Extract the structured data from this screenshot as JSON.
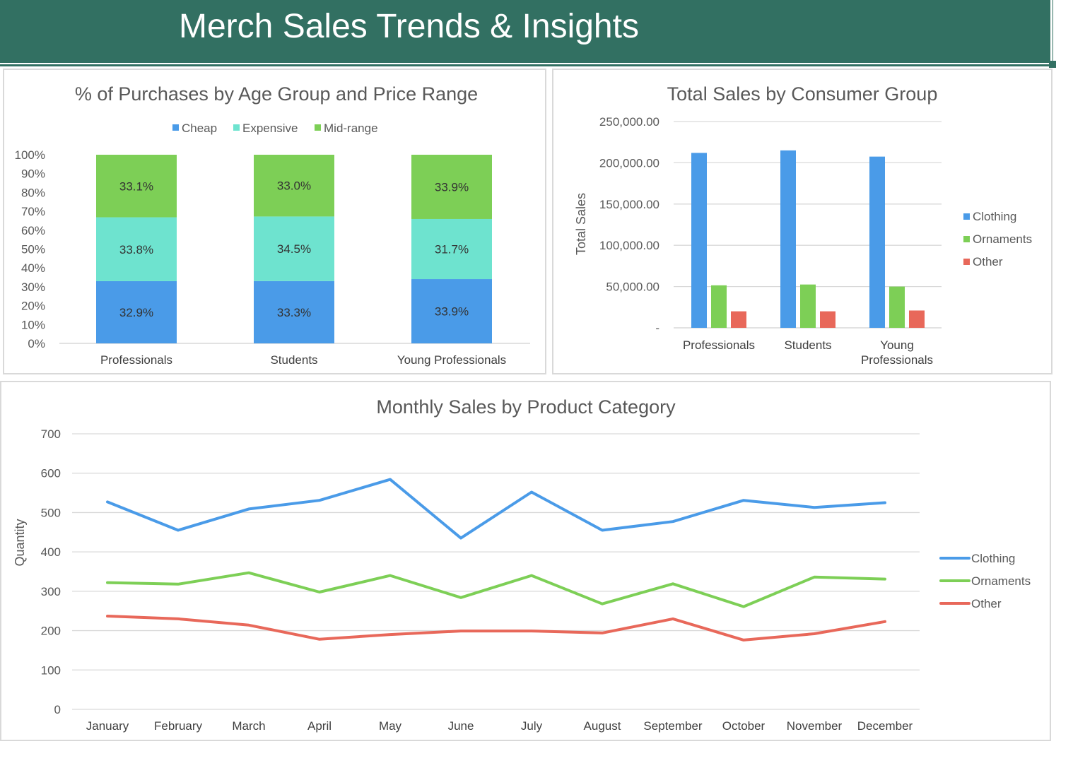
{
  "header": {
    "title": "Merch Sales Trends & Insights"
  },
  "colors": {
    "banner": "#327062",
    "clothing": "#4a9be8",
    "ornaments": "#7dcf56",
    "other": "#e8685a",
    "cheap": "#4a9be8",
    "expensive": "#6ee3cf",
    "midrange": "#7dcf56"
  },
  "chart_data": [
    {
      "type": "bar",
      "stacked": "percent",
      "title": "% of Purchases by Age Group and Price Range",
      "xlabel": "",
      "ylabel": "",
      "categories": [
        "Professionals",
        "Students",
        "Young Professionals"
      ],
      "series": [
        {
          "name": "Cheap",
          "values": [
            32.9,
            33.3,
            33.9
          ],
          "labels": [
            "32.9%",
            "33.3%",
            "33.9%"
          ]
        },
        {
          "name": "Expensive",
          "values": [
            33.8,
            34.5,
            31.7
          ],
          "labels": [
            "33.8%",
            "34.5%",
            "31.7%"
          ]
        },
        {
          "name": "Mid-range",
          "values": [
            33.1,
            33.0,
            33.9
          ],
          "labels": [
            "33.1%",
            "33.0%",
            "33.9%"
          ]
        }
      ],
      "yticks": [
        "0%",
        "10%",
        "20%",
        "30%",
        "40%",
        "50%",
        "60%",
        "70%",
        "80%",
        "90%",
        "100%"
      ],
      "ylim": [
        0,
        100
      ],
      "legend": "top"
    },
    {
      "type": "bar",
      "title": "Total Sales by Consumer Group",
      "xlabel": "",
      "ylabel": "Total Sales",
      "categories": [
        "Professionals",
        "Students",
        "Young Professionals"
      ],
      "series": [
        {
          "name": "Clothing",
          "values": [
            212000,
            215000,
            207500
          ]
        },
        {
          "name": "Ornaments",
          "values": [
            51500,
            52500,
            50000
          ]
        },
        {
          "name": "Other",
          "values": [
            20000,
            20000,
            21000
          ]
        }
      ],
      "yticks": [
        "-",
        "50,000.00",
        "100,000.00",
        "150,000.00",
        "200,000.00",
        "250,000.00"
      ],
      "ylim": [
        0,
        250000
      ],
      "grid": true,
      "legend": "right"
    },
    {
      "type": "line",
      "title": "Monthly Sales by Product Category",
      "xlabel": "",
      "ylabel": "Quantity",
      "categories": [
        "January",
        "February",
        "March",
        "April",
        "May",
        "June",
        "July",
        "August",
        "September",
        "October",
        "November",
        "December"
      ],
      "series": [
        {
          "name": "Clothing",
          "values": [
            527,
            455,
            509,
            531,
            584,
            435,
            552,
            455,
            477,
            531,
            513,
            525
          ]
        },
        {
          "name": "Ornaments",
          "values": [
            322,
            318,
            347,
            298,
            340,
            284,
            340,
            268,
            319,
            261,
            336,
            331
          ]
        },
        {
          "name": "Other",
          "values": [
            237,
            230,
            214,
            178,
            190,
            199,
            199,
            194,
            230,
            176,
            192,
            223
          ]
        }
      ],
      "yticks": [
        "0",
        "100",
        "200",
        "300",
        "400",
        "500",
        "600",
        "700"
      ],
      "ylim": [
        0,
        700
      ],
      "grid": true,
      "legend": "right"
    }
  ]
}
